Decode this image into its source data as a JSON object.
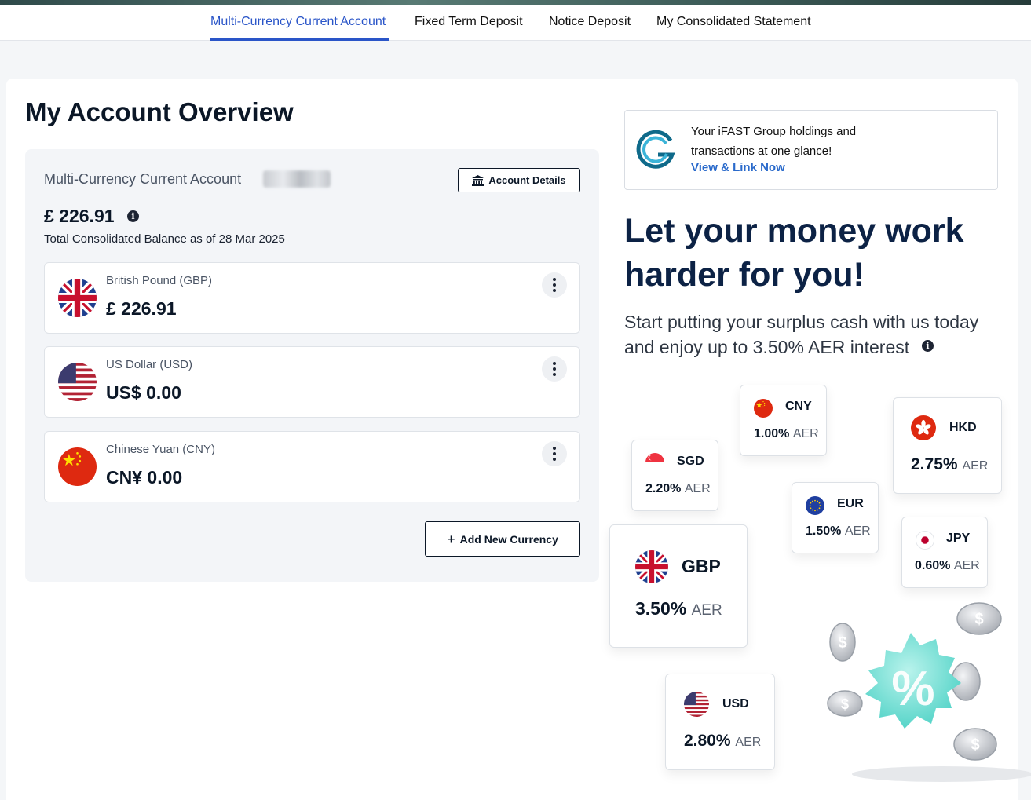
{
  "nav": {
    "tabs": [
      {
        "label": "Multi-Currency Current Account",
        "active": true
      },
      {
        "label": "Fixed Term Deposit"
      },
      {
        "label": "Notice Deposit"
      },
      {
        "label": "My Consolidated Statement"
      }
    ]
  },
  "overview": {
    "title": "My Account Overview",
    "account_name": "Multi-Currency Current Account",
    "account_details_label": "Account Details",
    "balance": "£ 226.91",
    "balance_sub": "Total Consolidated Balance as of 28 Mar 2025",
    "currencies": [
      {
        "label": "British Pound (GBP)",
        "amount": "£ 226.91",
        "flag": "uk-flag"
      },
      {
        "label": "US Dollar (USD)",
        "amount": "US$ 0.00",
        "flag": "us-flag"
      },
      {
        "label": "Chinese Yuan (CNY)",
        "amount": "CN¥ 0.00",
        "flag": "cn-flag"
      }
    ],
    "add_currency_label": "Add New Currency"
  },
  "promo": {
    "text_line1": "Your iFAST Group holdings and",
    "text_line2": "transactions at one glance!",
    "link": "View & Link Now",
    "headline_line1": "Let your money work",
    "headline_line2": "harder for you!",
    "sub_line1": "Start putting your surplus cash with us today",
    "sub_line2": "and enjoy up to 3.50% AER interest"
  },
  "rates": {
    "aer_label": "AER",
    "cny": {
      "code": "CNY",
      "rate": "1.00%"
    },
    "sgd": {
      "code": "SGD",
      "rate": "2.20%"
    },
    "hkd": {
      "code": "HKD",
      "rate": "2.75%"
    },
    "eur": {
      "code": "EUR",
      "rate": "1.50%"
    },
    "jpy": {
      "code": "JPY",
      "rate": "0.60%"
    },
    "gbp": {
      "code": "GBP",
      "rate": "3.50%"
    },
    "usd": {
      "code": "USD",
      "rate": "2.80%"
    }
  },
  "colors": {
    "accent": "#2a55c8",
    "link": "#2a6acb",
    "headline": "#0c2245"
  }
}
